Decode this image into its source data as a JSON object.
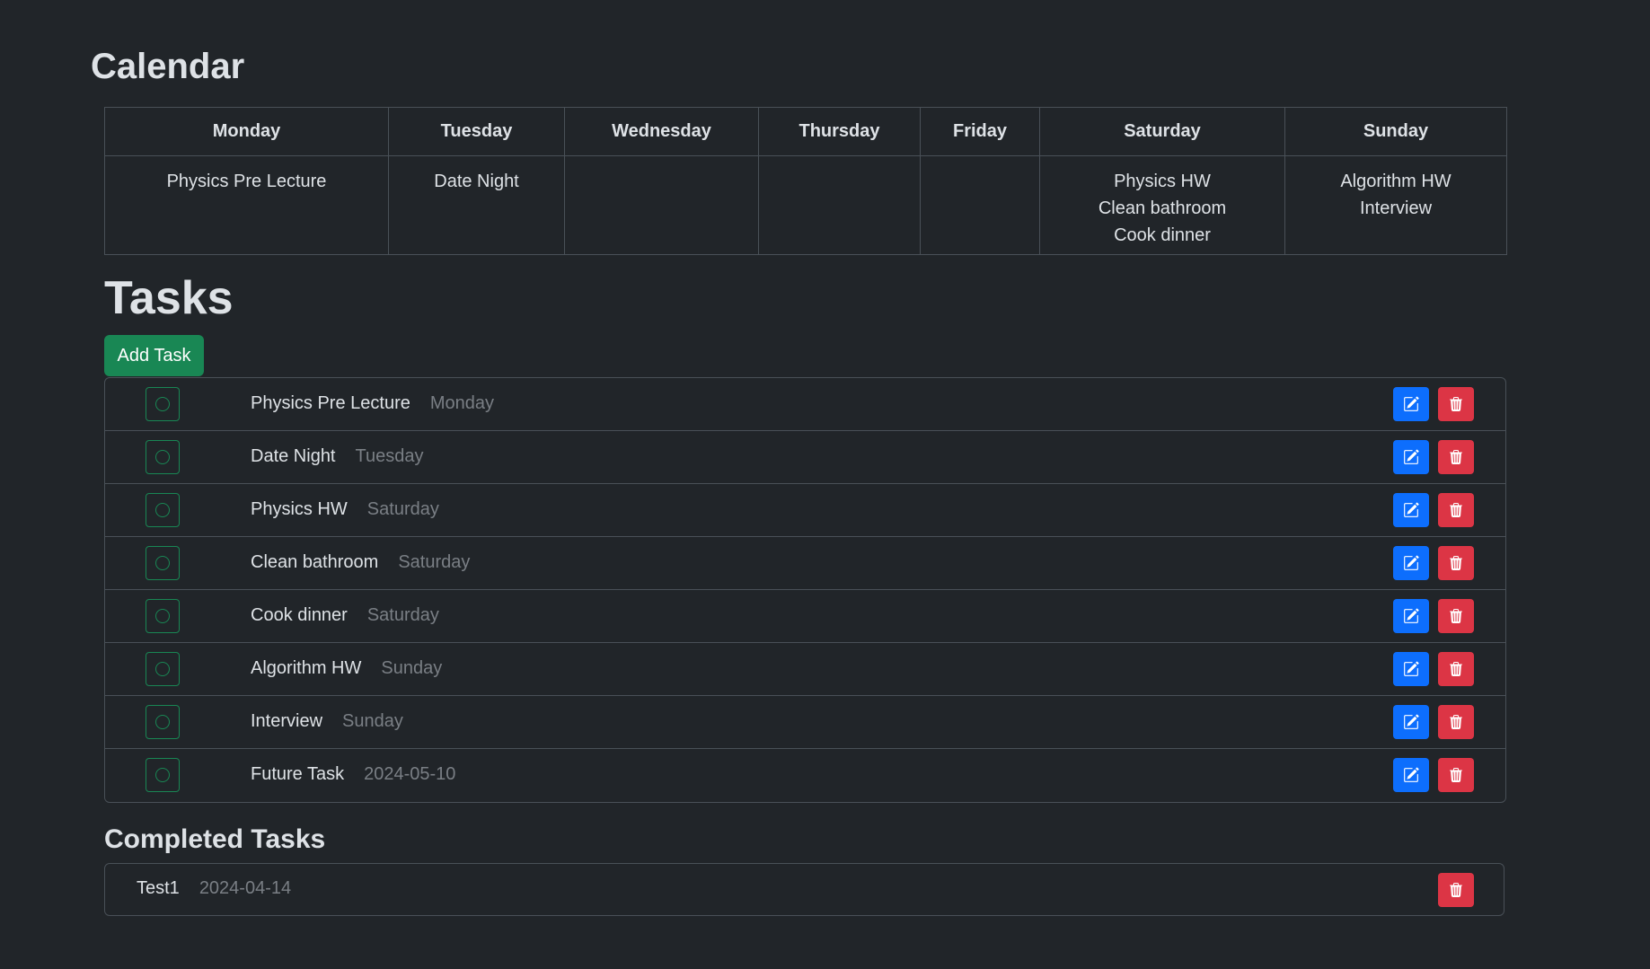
{
  "calendar": {
    "title": "Calendar",
    "days": [
      {
        "name": "Monday",
        "events": [
          "Physics Pre Lecture"
        ]
      },
      {
        "name": "Tuesday",
        "events": [
          "Date Night"
        ]
      },
      {
        "name": "Wednesday",
        "events": []
      },
      {
        "name": "Thursday",
        "events": []
      },
      {
        "name": "Friday",
        "events": []
      },
      {
        "name": "Saturday",
        "events": [
          "Physics HW",
          "Clean bathroom",
          "Cook dinner"
        ]
      },
      {
        "name": "Sunday",
        "events": [
          "Algorithm HW",
          "Interview"
        ]
      }
    ]
  },
  "tasks": {
    "title": "Tasks",
    "add_label": "Add Task",
    "items": [
      {
        "name": "Physics Pre Lecture",
        "day": "Monday"
      },
      {
        "name": "Date Night",
        "day": "Tuesday"
      },
      {
        "name": "Physics HW",
        "day": "Saturday"
      },
      {
        "name": "Clean bathroom",
        "day": "Saturday"
      },
      {
        "name": "Cook dinner",
        "day": "Saturday"
      },
      {
        "name": "Algorithm HW",
        "day": "Sunday"
      },
      {
        "name": "Interview",
        "day": "Sunday"
      },
      {
        "name": "Future Task",
        "day": "2024-05-10"
      }
    ]
  },
  "completed": {
    "title": "Completed Tasks",
    "items": [
      {
        "name": "Test1",
        "day": "2024-04-14"
      }
    ]
  },
  "colors": {
    "background": "#212529",
    "add_button": "#198754",
    "edit_button": "#0d6efd",
    "delete_button": "#dc3545",
    "muted_text": "#7a7f85"
  },
  "icons": {
    "check": "circle-icon",
    "edit": "pencil-square-icon",
    "delete": "trash-icon"
  }
}
